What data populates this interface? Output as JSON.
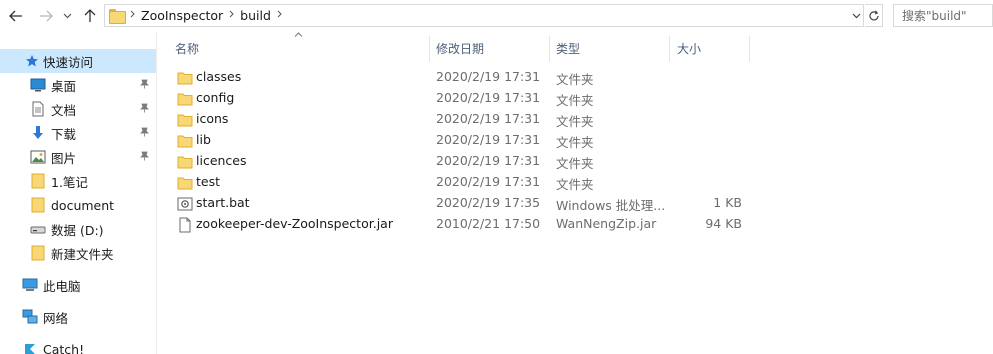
{
  "address": {
    "breadcrumb": [
      "ZooInspector",
      "build"
    ],
    "search_placeholder": "搜索\"build\""
  },
  "nav": {
    "quick_access": "快速访问",
    "items": [
      {
        "label": "桌面",
        "icon": "desktop-icon",
        "pinned": true
      },
      {
        "label": "文档",
        "icon": "document-icon",
        "pinned": true
      },
      {
        "label": "下载",
        "icon": "download-icon",
        "pinned": true
      },
      {
        "label": "图片",
        "icon": "picture-icon",
        "pinned": true
      },
      {
        "label": "1.笔记",
        "icon": "folder-icon",
        "pinned": false
      },
      {
        "label": "document",
        "icon": "folder-icon",
        "pinned": false
      },
      {
        "label": "数据 (D:)",
        "icon": "drive-icon",
        "pinned": false
      },
      {
        "label": "新建文件夹",
        "icon": "folder-icon",
        "pinned": false
      }
    ],
    "this_pc": "此电脑",
    "network": "网络",
    "catch": "Catch!"
  },
  "columns": {
    "name": "名称",
    "date": "修改日期",
    "type": "类型",
    "size": "大小"
  },
  "files": [
    {
      "name": "classes",
      "date": "2020/2/19 17:31",
      "type": "文件夹",
      "size": "",
      "icon": "folder-icon"
    },
    {
      "name": "config",
      "date": "2020/2/19 17:31",
      "type": "文件夹",
      "size": "",
      "icon": "folder-icon"
    },
    {
      "name": "icons",
      "date": "2020/2/19 17:31",
      "type": "文件夹",
      "size": "",
      "icon": "folder-icon"
    },
    {
      "name": "lib",
      "date": "2020/2/19 17:31",
      "type": "文件夹",
      "size": "",
      "icon": "folder-icon"
    },
    {
      "name": "licences",
      "date": "2020/2/19 17:31",
      "type": "文件夹",
      "size": "",
      "icon": "folder-icon"
    },
    {
      "name": "test",
      "date": "2020/2/19 17:31",
      "type": "文件夹",
      "size": "",
      "icon": "folder-icon"
    },
    {
      "name": "start.bat",
      "date": "2020/2/19 17:35",
      "type": "Windows 批处理...",
      "size": "1 KB",
      "icon": "batch-file-icon"
    },
    {
      "name": "zookeeper-dev-ZooInspector.jar",
      "date": "2010/2/21 17:50",
      "type": "WanNengZip.jar",
      "size": "94 KB",
      "icon": "jar-file-icon"
    }
  ]
}
